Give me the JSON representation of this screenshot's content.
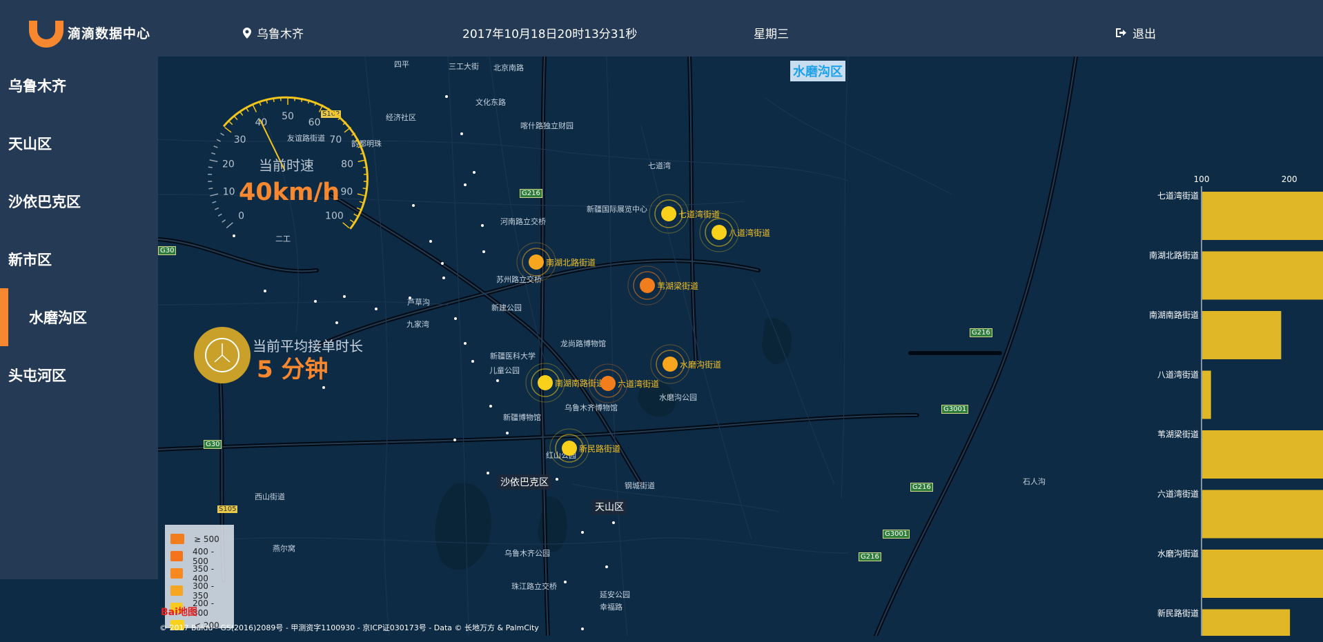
{
  "header": {
    "title": "滴滴数据中心",
    "city": "乌鲁木齐",
    "datetime": "2017年10月18日20时13分31秒",
    "weekday": "星期三",
    "logout": "退出"
  },
  "sidebar": {
    "items": [
      {
        "label": "乌鲁木齐"
      },
      {
        "label": "天山区"
      },
      {
        "label": "沙依巴克区"
      },
      {
        "label": "新市区"
      },
      {
        "label": "水磨沟区",
        "active": true
      },
      {
        "label": "头屯河区"
      }
    ]
  },
  "map": {
    "selected_region": "水磨沟区",
    "speed_label": "当前时速",
    "speed_value": "40km/h",
    "speed_kmh": 40,
    "gauge_ticks": [
      "0",
      "10",
      "20",
      "30",
      "40",
      "50",
      "60",
      "70",
      "80",
      "90",
      "100"
    ],
    "wait_label": "当前平均接单时长",
    "wait_value": "5 分钟",
    "hotspots": [
      {
        "name": "七道湾街道",
        "color": "#f9d11b"
      },
      {
        "name": "八道湾街道",
        "color": "#f9d11b"
      },
      {
        "name": "南湖北路街道",
        "color": "#f7a61e"
      },
      {
        "name": "苇湖梁街道",
        "color": "#f27d1c"
      },
      {
        "name": "水磨沟街道",
        "color": "#f7a61e"
      },
      {
        "name": "南湖南路街道",
        "color": "#f9d11b"
      },
      {
        "name": "六道湾街道",
        "color": "#f27d1c"
      },
      {
        "name": "新民路街道",
        "color": "#f9d11b"
      }
    ],
    "labels": {
      "districts": [
        "沙依巴克区",
        "天山区"
      ],
      "roads_badges_green": [
        "G216",
        "G30",
        "G30",
        "G216",
        "G3001",
        "G216",
        "G3001",
        "G216"
      ],
      "roads_badges_yellow": [
        "S102",
        "S105"
      ],
      "places": [
        "四平",
        "三工大街",
        "北京南路",
        "文化东路",
        "喀什路独立财园",
        "友谊路街道",
        "韵都明珠",
        "经济社区",
        "新疆国际展览中心",
        "苏州路立交桥",
        "河南路立交桥",
        "新建公园",
        "新疆医科大学",
        "儿童公园",
        "龙尚路博物馆",
        "乌鲁木齐博物馆",
        "新疆博物馆",
        "红山公园",
        "水磨沟公园",
        "延安公园",
        "幸福路",
        "乌鲁木齐公园",
        "珠江路立交桥",
        "钢城街道",
        "西山街道",
        "燕尔窝",
        "九家湾",
        "二工",
        "芦草沟",
        "七道湾",
        "石人沟"
      ]
    },
    "legend": [
      {
        "label": "≥ 500",
        "color": "#f27d1c"
      },
      {
        "label": "400 - 500",
        "color": "#f5731a"
      },
      {
        "label": "350 - 400",
        "color": "#f7891e"
      },
      {
        "label": "300 - 350",
        "color": "#f8a621"
      },
      {
        "label": "200 - 300",
        "color": "#f9c91f"
      },
      {
        "label": "< 200",
        "color": "#f9d11b"
      }
    ],
    "baidu_logo": "Bai地图",
    "copyright": "© 2017 Baidu - GS(2016)2089号 - 甲测资字1100930 - 京ICP证030173号 - Data © 长地万方 & PalmCity"
  },
  "chart_data": {
    "type": "bar",
    "orientation": "horizontal",
    "categories": [
      "七道湾街道",
      "南湖北路街道",
      "南湖南路街道",
      "八道湾街道",
      "苇湖梁街道",
      "六道湾街道",
      "水磨沟街道",
      "新民路街道"
    ],
    "values": [
      280,
      300,
      190,
      110,
      460,
      430,
      300,
      200
    ],
    "xlim": [
      100,
      450
    ],
    "xticks": [
      100,
      200,
      300,
      400
    ],
    "color": "#e0b727"
  }
}
